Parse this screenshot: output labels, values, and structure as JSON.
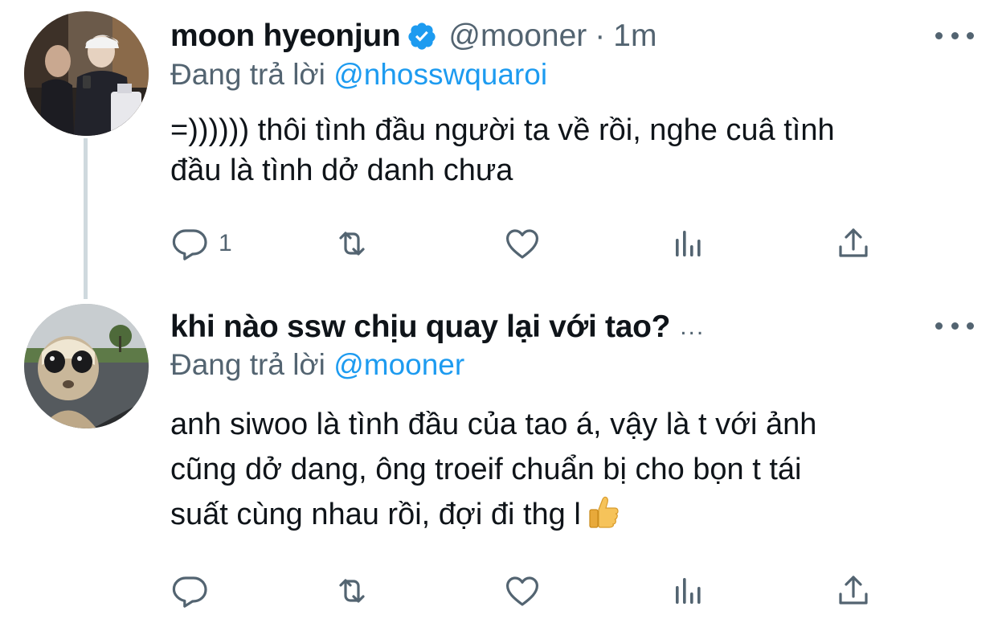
{
  "tweets": [
    {
      "display_name": "moon hyeonjun",
      "verified": true,
      "handle": "@mooner",
      "separator": "·",
      "time": "1m",
      "reply_prefix": "Đang trả lời",
      "reply_mention": "@nhosswquaroi",
      "text_lines": [
        "=)))))) thôi tình đầu người ta về rồi, nghe cuâ tình",
        "đầu là tình dở danh chưa"
      ],
      "actions": {
        "reply_count": "1"
      }
    },
    {
      "display_name": "khi nào ssw chịu quay lại với tao?",
      "name_truncation": "...",
      "reply_prefix": "Đang trả lời",
      "reply_mention": "@mooner",
      "text_lines": [
        "anh siwoo là tình đầu của tao á, vậy là t với ảnh",
        "cũng dở dang, ông troeif chuẩn bị cho bọn t tái",
        "suất cùng nhau rồi, đợi đi thg l"
      ],
      "emoji": "thumbs-up-emoji",
      "actions": {
        "reply_count": ""
      }
    }
  ],
  "colors": {
    "text": "#0f1419",
    "secondary": "#536471",
    "link": "#1d9bf0",
    "thread_line": "#cfd9de"
  },
  "icons": [
    "reply-icon",
    "retweet-icon",
    "like-icon",
    "analytics-icon",
    "share-icon",
    "more-icon",
    "verified-icon"
  ]
}
